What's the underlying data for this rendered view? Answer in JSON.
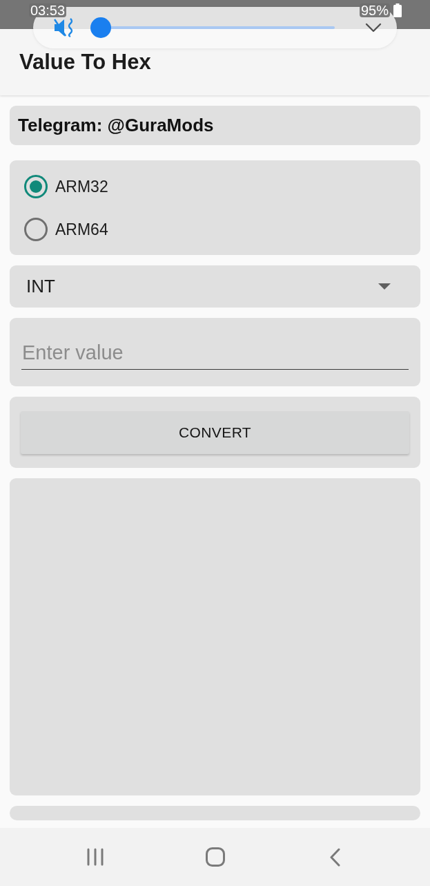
{
  "status_bar": {
    "time": "03:53",
    "battery": "95%"
  },
  "volume_panel": {
    "muted": true,
    "level": 0
  },
  "app_bar": {
    "title": "Value To Hex"
  },
  "telegram_banner": {
    "text": "Telegram: @GuraMods"
  },
  "architecture_options": [
    {
      "label": "ARM32",
      "selected": true
    },
    {
      "label": "ARM64",
      "selected": false
    }
  ],
  "type_dropdown": {
    "value": "INT"
  },
  "value_field": {
    "placeholder": "Enter value"
  },
  "convert_button": {
    "label": "CONVERT"
  }
}
